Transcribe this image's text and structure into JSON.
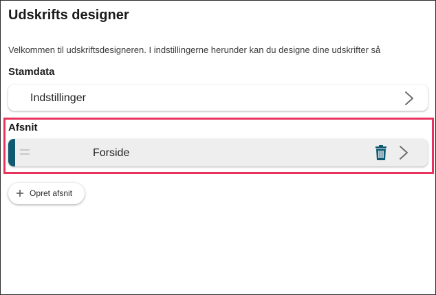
{
  "page": {
    "title": "Udskrifts designer",
    "intro": "Velkommen til udskriftsdesigneren. I indstillingerne herunder kan du designe dine udskrifter så"
  },
  "stamdata": {
    "heading": "Stamdata",
    "items": [
      {
        "label": "Indstillinger",
        "icon": "chevron-right-icon"
      }
    ]
  },
  "afsnit": {
    "heading": "Afsnit",
    "items": [
      {
        "label": "Forside",
        "accent_color": "#0f5a72",
        "icons": [
          "drag-handle-icon",
          "trash-icon",
          "chevron-right-icon"
        ]
      }
    ],
    "create_button": {
      "label": "Opret afsnit",
      "icon": "plus-icon"
    }
  },
  "colors": {
    "accent": "#0f5a72",
    "highlight": "#e8335d"
  }
}
